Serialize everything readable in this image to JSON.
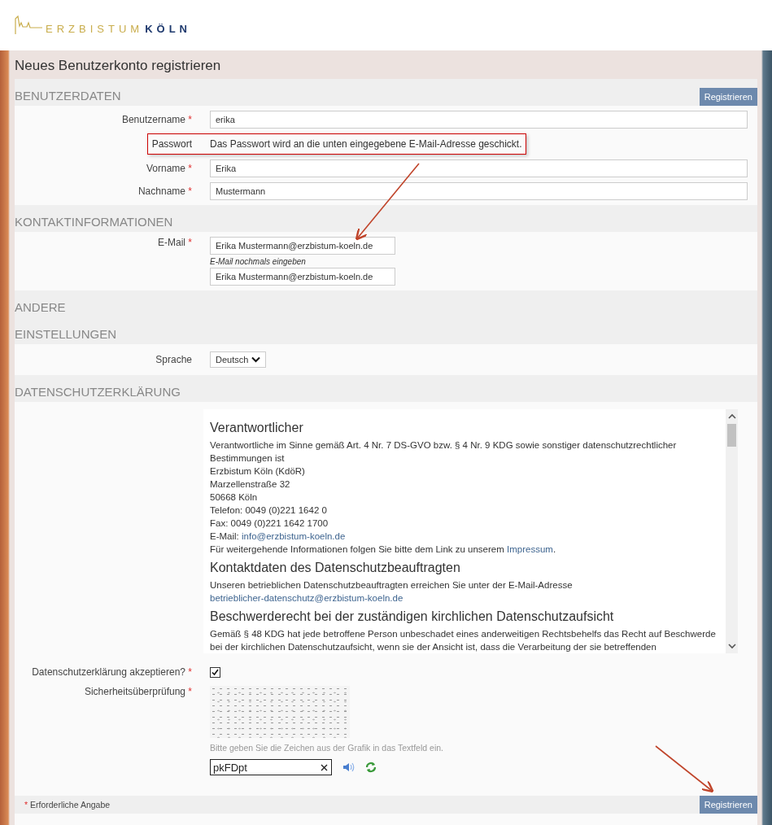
{
  "logo": {
    "text_1": "ERZBISTUM",
    "text_2": "KÖLN"
  },
  "page_title": "Neues Benutzerkonto registrieren",
  "required_mark": "*",
  "top_button": "Registrieren",
  "sections": [
    {
      "title": "BENUTZERDATEN",
      "fields": [
        {
          "kind": "input",
          "label": "Benutzername",
          "required": true,
          "value": "erika"
        },
        {
          "kind": "note",
          "label": "Passwort",
          "text": "Das Passwort wird an die unten eingegebene E-Mail-Adresse geschickt.",
          "highlighted": true
        },
        {
          "kind": "input",
          "label": "Vorname",
          "required": true,
          "value": "Erika"
        },
        {
          "kind": "input",
          "label": "Nachname",
          "required": true,
          "value": "Mustermann"
        }
      ]
    },
    {
      "title": "KONTAKTINFORMATIONEN",
      "fields": [
        {
          "kind": "email",
          "label": "E-Mail",
          "required": true,
          "value": "Erika Mustermann@erzbistum-koeln.de",
          "confirm_label": "E-Mail nochmals eingeben",
          "confirm_value": "Erika Mustermann@erzbistum-koeln.de"
        }
      ]
    },
    {
      "title": "ANDERE"
    },
    {
      "title": "EINSTELLUNGEN",
      "fields": [
        {
          "kind": "select",
          "label": "Sprache",
          "value": "Deutsch"
        }
      ]
    },
    {
      "title": "DATENSCHUTZERKLÄRUNG",
      "fields": [
        {
          "kind": "privacy",
          "blocks": [
            {
              "kind": "heading",
              "text": "Verantwortlicher"
            },
            {
              "kind": "line",
              "text": "Verantwortliche im Sinne gemäß Art. 4 Nr. 7 DS-GVO bzw. § 4 Nr. 9 KDG sowie sonstiger datenschutzrechtlicher Bestimmungen ist"
            },
            {
              "kind": "line",
              "text": "Erzbistum Köln (KdöR)"
            },
            {
              "kind": "line",
              "text": "Marzellenstraße 32"
            },
            {
              "kind": "line",
              "text": "50668 Köln"
            },
            {
              "kind": "line",
              "text": "Telefon: 0049 (0)221 1642 0"
            },
            {
              "kind": "line",
              "text": "Fax: 0049 (0)221 1642 1700"
            },
            {
              "kind": "line",
              "text": "E-Mail:",
              "link": "info@erzbistum-koeln.de"
            },
            {
              "kind": "line",
              "text": "Für weitergehende Informationen folgen Sie bitte dem Link zu unserem",
              "link": "Impressum",
              "after": "."
            },
            {
              "kind": "heading",
              "text": "Kontaktdaten des Datenschutzbeauftragten"
            },
            {
              "kind": "line",
              "text": "Unseren betrieblichen Datenschutzbeauftragten erreichen Sie unter der E-Mail-Adresse",
              "link": "betrieblicher-datenschutz@erzbistum-koeln.de"
            },
            {
              "kind": "heading",
              "text": "Beschwerderecht bei der zuständigen kirchlichen Datenschutzaufsicht"
            },
            {
              "kind": "line",
              "text": "Gemäß § 48 KDG hat jede betroffene Person unbeschadet eines anderweitigen Rechtsbehelfs das Recht auf Beschwerde bei der kirchlichen Datenschutzaufsicht, wenn sie der Ansicht ist, dass die Verarbeitung der sie betreffenden"
            }
          ]
        }
      ]
    }
  ],
  "accept": {
    "label": "Datenschutzerklärung akzeptieren?",
    "required": true,
    "checked": true
  },
  "captcha": {
    "label": "Sicherheitsüberprüfung",
    "required": true,
    "hint": "Bitte geben Sie die Zeichen aus der Grafik in das Textfeld ein.",
    "value": "pkFDpt"
  },
  "footer": {
    "mark": "*",
    "note": "Erforderliche Angabe",
    "button": "Registrieren"
  }
}
